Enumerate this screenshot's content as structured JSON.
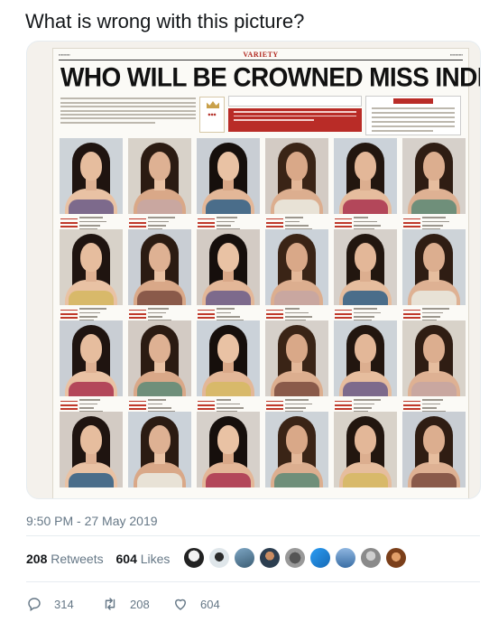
{
  "tweet": {
    "text": "What is wrong with this picture?",
    "timestamp": "9:50 PM - 27 May 2019"
  },
  "newspaper": {
    "section": "VARIETY",
    "headline": "WHO WILL BE CROWNED MISS INDIA THIS YEAR?",
    "photo_rows": 4,
    "photo_columns": 6
  },
  "stats": {
    "retweets_count": "208",
    "retweets_label": "Retweets",
    "likes_count": "604",
    "likes_label": "Likes"
  },
  "actions": {
    "reply_count": "314",
    "retweet_count": "208",
    "like_count": "604"
  },
  "colors": {
    "text_primary": "#14171a",
    "text_secondary": "#657786",
    "divider": "#e6ecf0",
    "newspaper_accent": "#b92c27"
  },
  "icons": {
    "reply": "reply-icon",
    "retweet": "retweet-icon",
    "like": "heart-icon"
  }
}
